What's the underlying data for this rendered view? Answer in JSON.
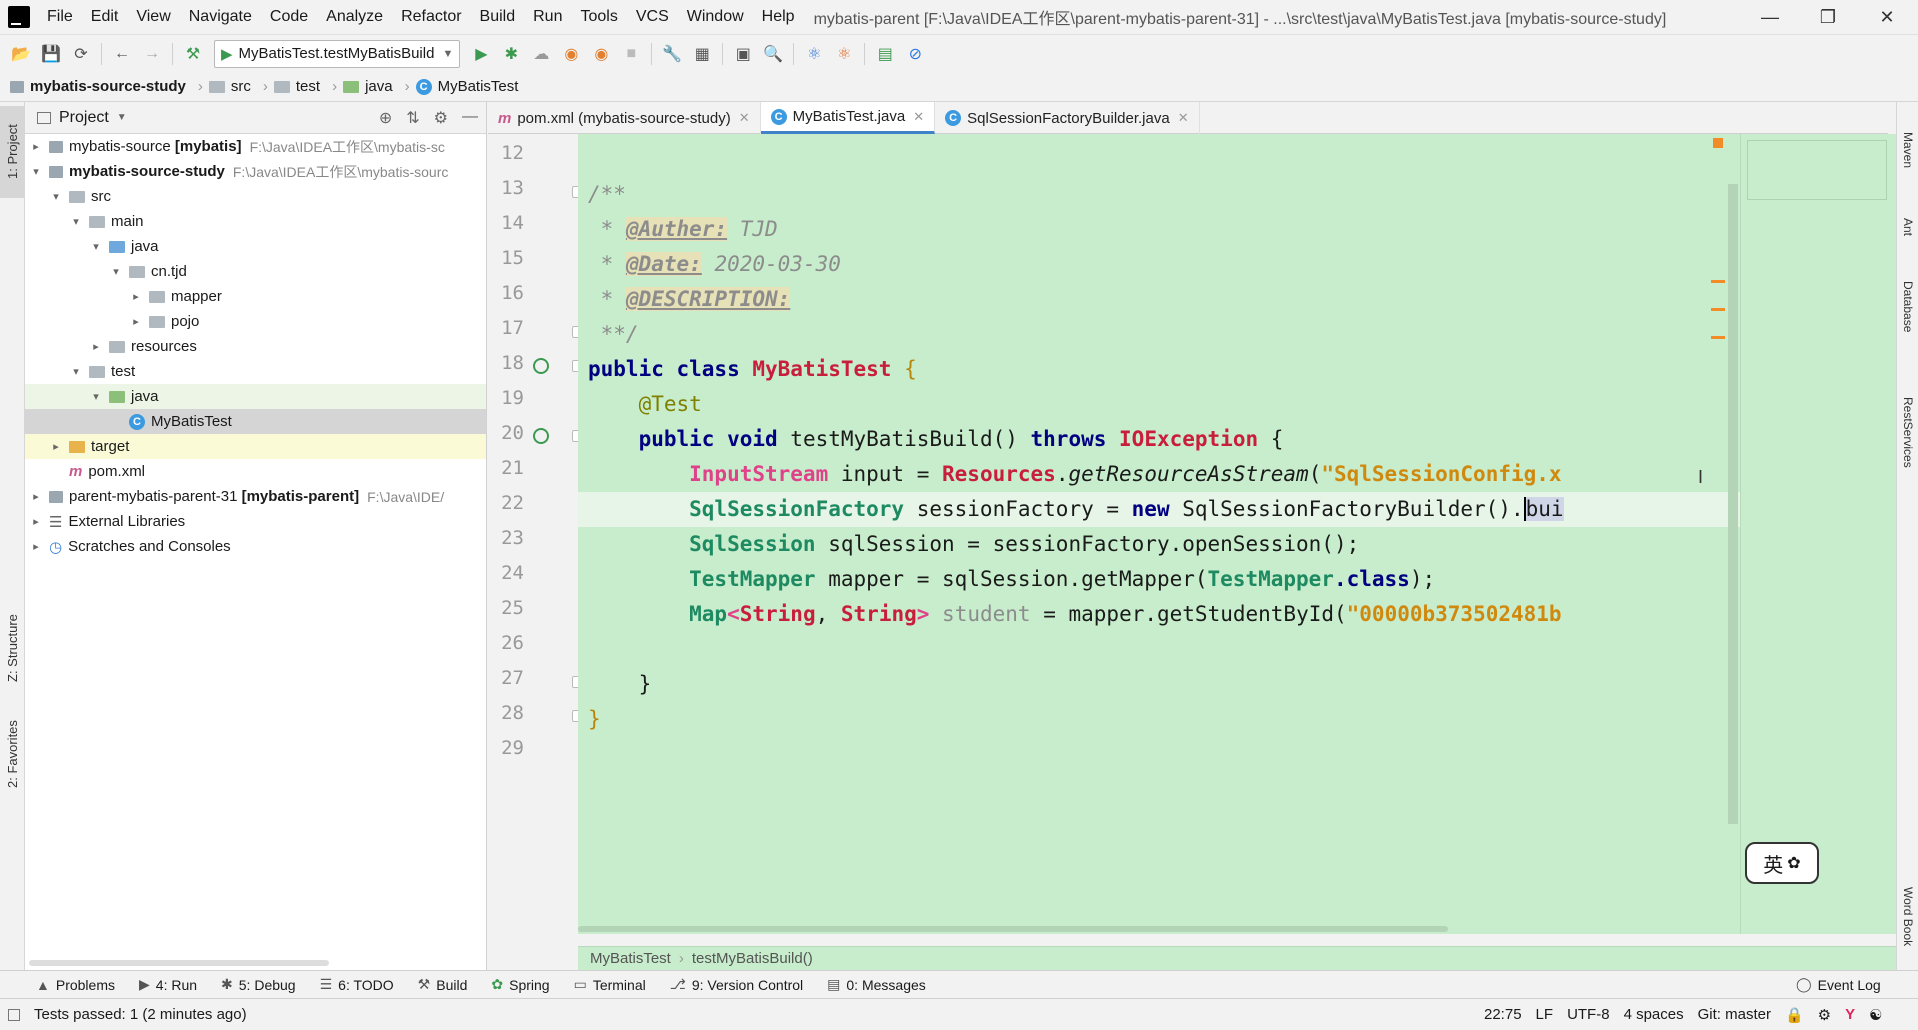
{
  "menubar": {
    "items": [
      "File",
      "Edit",
      "View",
      "Navigate",
      "Code",
      "Analyze",
      "Refactor",
      "Build",
      "Run",
      "Tools",
      "VCS",
      "Window",
      "Help"
    ],
    "window_title": "mybatis-parent [F:\\Java\\IDEA工作区\\parent-mybatis-parent-31] - ...\\src\\test\\java\\MyBatisTest.java [mybatis-source-study]"
  },
  "toolbar": {
    "run_config": "MyBatisTest.testMyBatisBuild"
  },
  "navbar": {
    "crumbs": [
      "mybatis-source-study",
      "src",
      "test",
      "java",
      "MyBatisTest"
    ]
  },
  "left_stripe": {
    "project": "1: Project",
    "structure": "Z: Structure",
    "favorites": "2: Favorites"
  },
  "project_panel": {
    "title": "Project",
    "rows": [
      {
        "name": "mybatis-source",
        "bold_suffix": "[mybatis]",
        "path": "F:\\Java\\IDEA工作区\\mybatis-sc"
      },
      {
        "name": "mybatis-source-study",
        "path": "F:\\Java\\IDEA工作区\\mybatis-sourc"
      },
      {
        "name": "src"
      },
      {
        "name": "main"
      },
      {
        "name": "java"
      },
      {
        "name": "cn.tjd"
      },
      {
        "name": "mapper"
      },
      {
        "name": "pojo"
      },
      {
        "name": "resources"
      },
      {
        "name": "test"
      },
      {
        "name": "java"
      },
      {
        "name": "MyBatisTest"
      },
      {
        "name": "target"
      },
      {
        "name": "pom.xml"
      },
      {
        "name": "parent-mybatis-parent-31",
        "bold_suffix": "[mybatis-parent]",
        "path": "F:\\Java\\IDE/"
      },
      {
        "name": "External Libraries"
      },
      {
        "name": "Scratches and Consoles"
      }
    ]
  },
  "tabs": [
    {
      "label": "pom.xml (mybatis-source-study)"
    },
    {
      "label": "MyBatisTest.java"
    },
    {
      "label": "SqlSessionFactoryBuilder.java"
    }
  ],
  "editor": {
    "line_numbers": [
      "12",
      "13",
      "14",
      "15",
      "16",
      "17",
      "18",
      "19",
      "20",
      "21",
      "22",
      "23",
      "24",
      "25",
      "26",
      "27",
      "28",
      "29"
    ],
    "tokens": {
      "l13": "/**",
      "l14_a": " * ",
      "l14_tag": "@Auther:",
      "l14_val": " TJD",
      "l15_a": " * ",
      "l15_tag": "@Date:",
      "l15_val": " 2020-03-30",
      "l16_a": " * ",
      "l16_tag": "@DESCRIPTION:",
      "l17": " **/",
      "l18_kw": "public class ",
      "l18_cls": "MyBatisTest",
      "l18_b": " {",
      "l19": "    @Test",
      "l20_kw": "    public void ",
      "l20_m": "testMyBatisBuild() ",
      "l20_kw2": "throws ",
      "l20_ex": "IOException",
      "l20_b": " {",
      "l21_t": "        InputStream",
      "l21_v": " input = ",
      "l21_c": "Resources",
      "l21_d": ".",
      "l21_m": "getResourceAsStream",
      "l21_p": "(",
      "l21_s": "\"SqlSessionConfig.x",
      "l22_t": "        SqlSessionFactory",
      "l22_v": " sessionFactory = ",
      "l22_kw": "new ",
      "l22_c": "SqlSessionFactoryBuilder().",
      "l22_cur": "bui",
      "l23_t": "        SqlSession",
      "l23_v": " sqlSession = sessionFactory.openSession();",
      "l24_t": "        TestMapper",
      "l24_v": " mapper = sqlSession.getMapper(",
      "l24_t2": "TestMapper",
      "l24_kw": ".class",
      "l24_e": ");",
      "l25_t": "        Map",
      "l25_a": "<",
      "l25_t2": "String",
      "l25_c": ", ",
      "l25_t3": "String",
      "l25_g": "> ",
      "l25_d": "student",
      "l25_v": " = mapper.getStudentById(",
      "l25_s": "\"00000b373502481b",
      "l27": "    }",
      "l28": "}"
    }
  },
  "editor_breadcrumb": [
    "MyBatisTest",
    "testMyBatisBuild()"
  ],
  "right_stripe": [
    "Maven",
    "Ant",
    "Database",
    "RestServices",
    "Word Book"
  ],
  "bottom_tools": [
    "Problems",
    "4: Run",
    "5: Debug",
    "6: TODO",
    "Build",
    "Spring",
    "Terminal",
    "9: Version Control",
    "0: Messages"
  ],
  "event_log": "Event Log",
  "status": {
    "message": "Tests passed: 1 (2 minutes ago)",
    "position": "22:75",
    "line_sep": "LF",
    "encoding": "UTF-8",
    "indent": "4 spaces",
    "git": "Git: master"
  },
  "ime": {
    "label": "英"
  },
  "colors": {
    "editor_bg": "#c7edcc",
    "keyword": "#000080",
    "class": "#c81e3c",
    "type": "#1e8a62",
    "string": "#d0890f"
  }
}
